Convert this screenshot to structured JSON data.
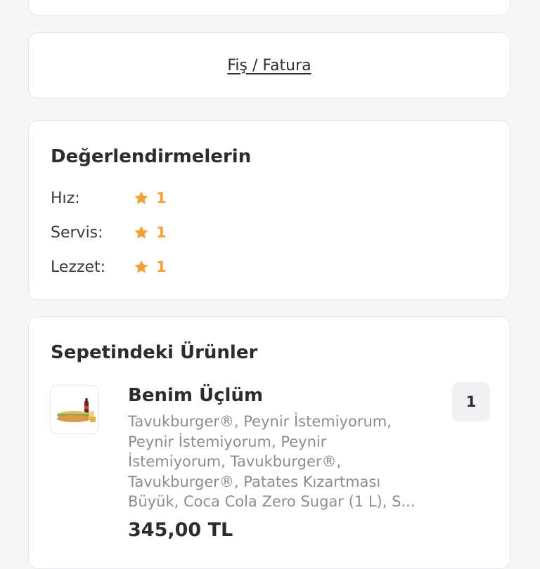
{
  "receipt": {
    "label": "Fiş / Fatura"
  },
  "ratings": {
    "title": "Değerlendirmelerin",
    "items": [
      {
        "label": "Hız:",
        "value": "1"
      },
      {
        "label": "Servis:",
        "value": "1"
      },
      {
        "label": "Lezzet:",
        "value": "1"
      }
    ],
    "star_color": "#f5a034"
  },
  "basket": {
    "title": "Sepetindeki Ürünler",
    "product": {
      "name": "Benim Üçlüm",
      "description_lines": [
        "Tavukburger®, Peynir İstemiyorum,",
        "Peynir İstemiyorum, Peynir",
        "İstemiyorum, Tavukburger®,",
        "Tavukburger®, Patates Kızartması",
        "Büyük, Coca Cola Zero Sugar (1 L), S..."
      ],
      "quantity": "1",
      "price": "345,00 TL",
      "image": "burger-menu-thumbnail"
    }
  }
}
